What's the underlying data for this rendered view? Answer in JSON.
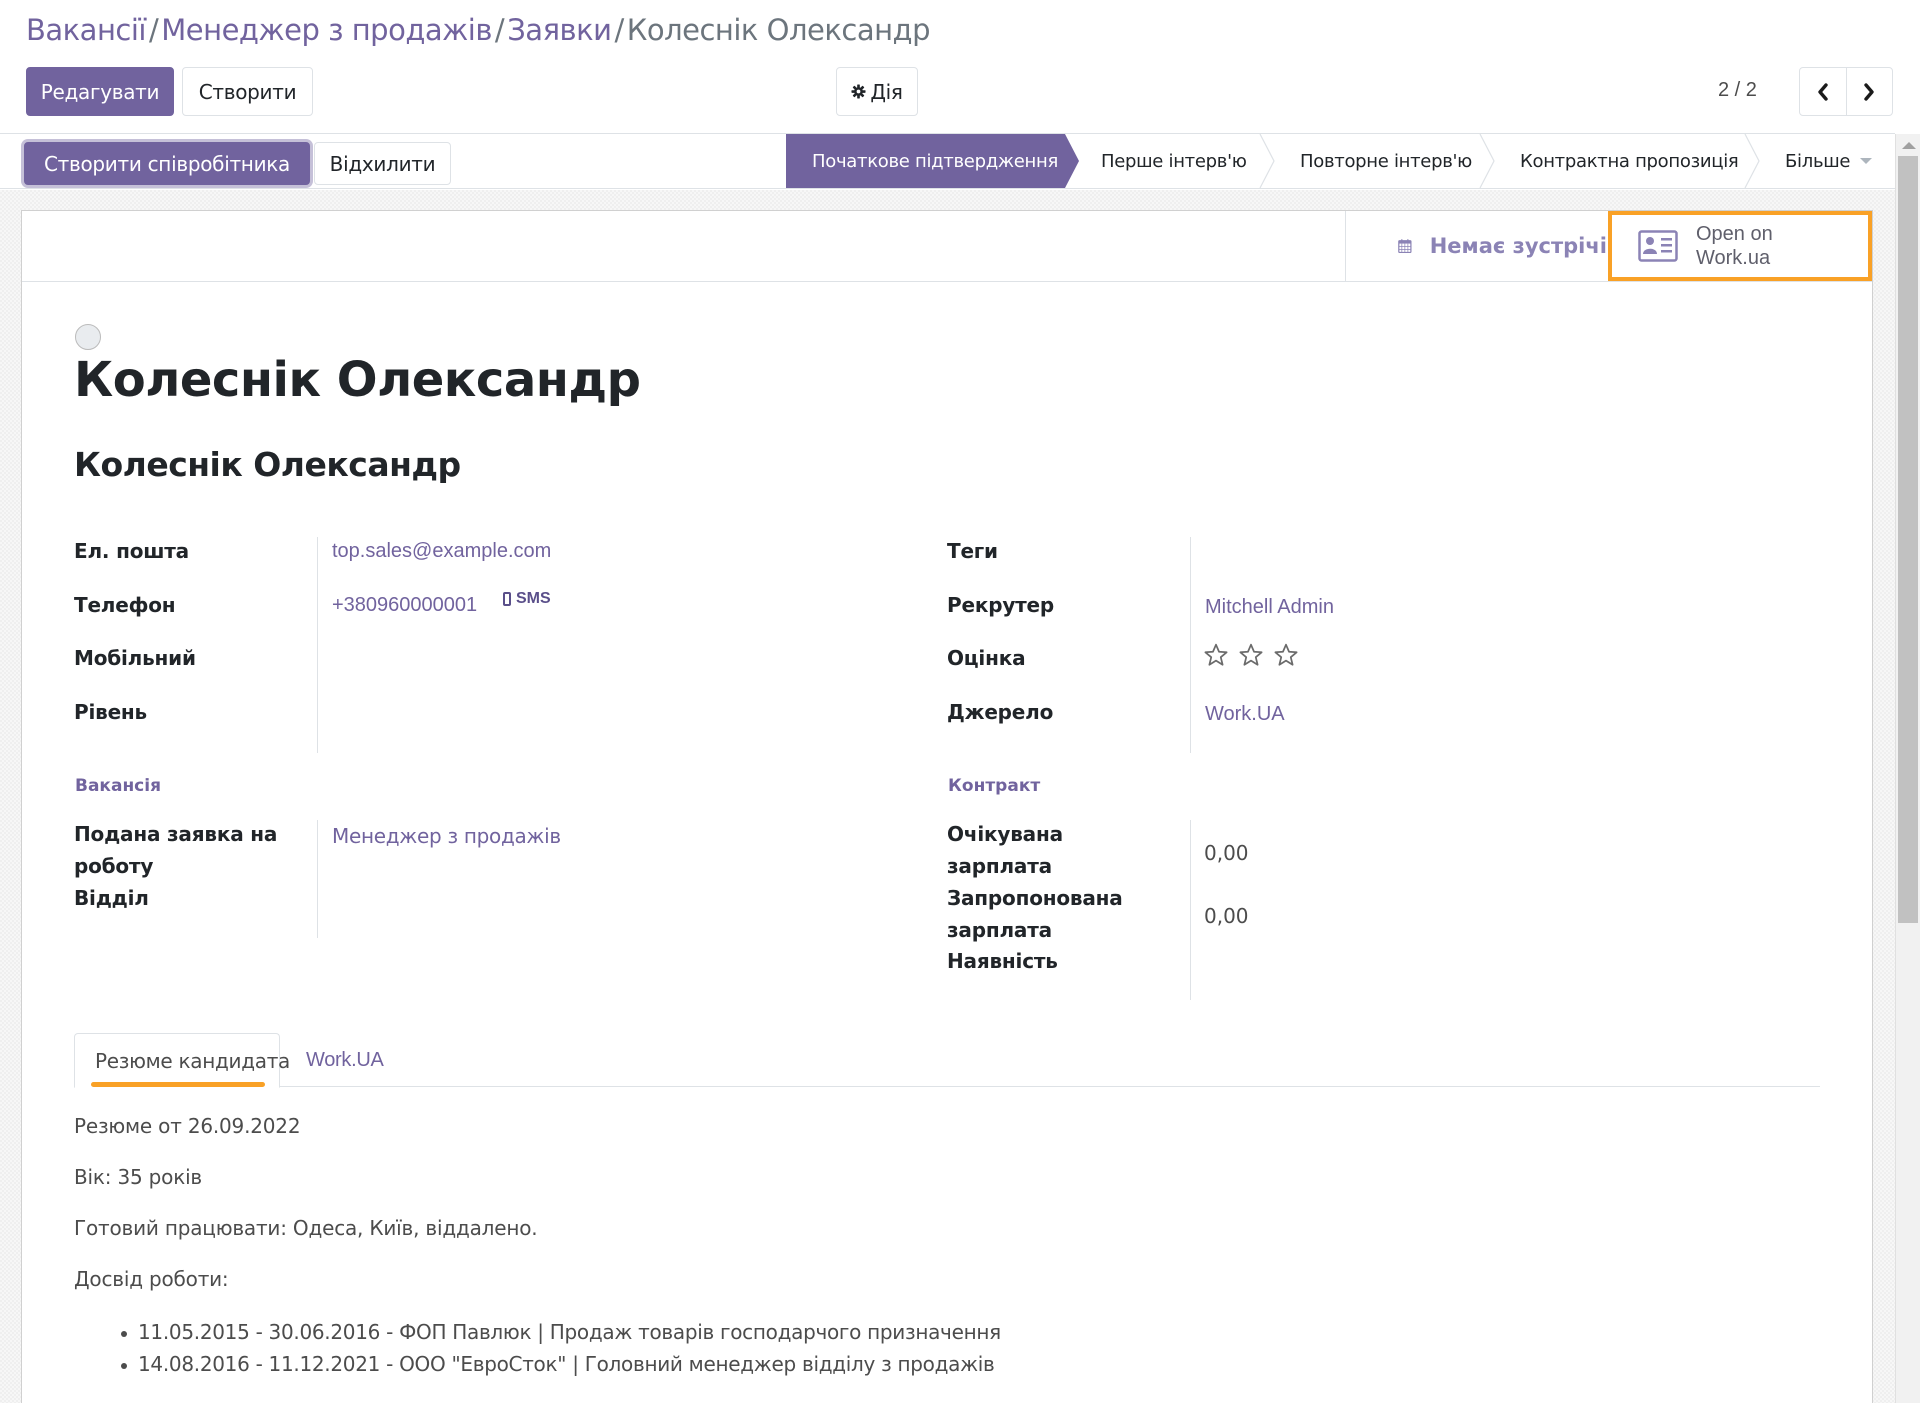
{
  "breadcrumb": {
    "items": [
      "Вакансії",
      "Менеджер з продажів",
      "Заявки"
    ],
    "separator": "/",
    "current": "Колеснік Олександр"
  },
  "toolbar": {
    "edit_label": "Редагувати",
    "create_label": "Створити",
    "action_label": "Дія",
    "action_icon": "gear-icon"
  },
  "pager": {
    "value": "2 / 2",
    "prev_icon": "chevron-left-icon",
    "next_icon": "chevron-right-icon"
  },
  "statusbar": {
    "buttons": {
      "create_employee": "Створити співробітника",
      "refuse": "Відхилити"
    },
    "stages": [
      {
        "label": "Початкове підтвердження",
        "active": true
      },
      {
        "label": "Перше інтерв'ю",
        "active": false
      },
      {
        "label": "Повторне інтерв'ю",
        "active": false
      },
      {
        "label": "Контрактна пропозиція",
        "active": false
      }
    ],
    "more_label": "Більше"
  },
  "button_box": {
    "meetings": {
      "label": "Немає зустрічі",
      "icon": "calendar-icon"
    },
    "workua": {
      "line1": "Open on",
      "line2": "Work.ua",
      "icon": "id-card-icon",
      "highlight_color": "#f9a126"
    }
  },
  "record": {
    "title": "Колеснік Олександр",
    "subtitle": "Колеснік Олександр",
    "priority_starred": false
  },
  "left_group": {
    "email": {
      "label": "Ел. пошта",
      "value": "top.sales@example.com"
    },
    "phone": {
      "label": "Телефон",
      "value": "+380960000001",
      "sms_label": "SMS"
    },
    "mobile": {
      "label": "Мобільний",
      "value": ""
    },
    "degree": {
      "label": "Рівень",
      "value": ""
    }
  },
  "right_group": {
    "tags": {
      "label": "Теги",
      "value": ""
    },
    "recruiter": {
      "label": "Рекрутер",
      "value": "Mitchell Admin"
    },
    "evaluation": {
      "label": "Оцінка",
      "stars_total": 3,
      "stars_filled": 0
    },
    "source": {
      "label": "Джерело",
      "value": "Work.UA"
    }
  },
  "job_section": {
    "title": "Вакансія",
    "applied_job": {
      "label_line1": "Подана заявка на",
      "label_line2": "роботу",
      "value": "Менеджер з продажів"
    },
    "department": {
      "label": "Відділ",
      "value": ""
    }
  },
  "contract_section": {
    "title": "Контракт",
    "expected_salary": {
      "label_line1": "Очікувана",
      "label_line2": "зарплата",
      "value": "0,00"
    },
    "proposed_salary": {
      "label_line1": "Запропонована",
      "label_line2": "зарплата",
      "value": "0,00"
    },
    "availability": {
      "label": "Наявність",
      "value": ""
    }
  },
  "tabs": [
    {
      "label": "Резюме кандидата",
      "active": true
    },
    {
      "label": "Work.UA",
      "active": false
    }
  ],
  "resume": {
    "paragraphs": [
      "Резюме от 26.09.2022",
      "Вік: 35 років",
      "Готовий працювати: Одеса, Київ, віддалено.",
      "Досвід роботи:"
    ],
    "experience": [
      "11.05.2015 - 30.06.2016 - ФОП Павлюк | Продаж товарів господарчого призначення",
      "14.08.2016 - 11.12.2021 - ООО \"ЕвроСток\" | Головний менеджер відділу з продажів"
    ]
  },
  "colors": {
    "brand": "#71639e",
    "highlight": "#f9a126",
    "text": "#212529",
    "muted": "#4c4c4c"
  }
}
